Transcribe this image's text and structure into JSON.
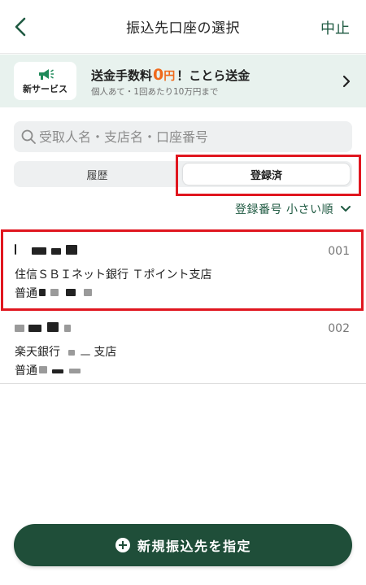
{
  "header": {
    "title": "振込先口座の選択",
    "cancel_label": "中止"
  },
  "banner": {
    "badge_label": "新サービス",
    "title_prefix": "送金手数料",
    "fee_amount": "0",
    "fee_unit": "円",
    "title_suffix": "！ことら送金",
    "subtitle": "個人あて・1回あたり10万円まで"
  },
  "search": {
    "placeholder": "受取人名・支店名・口座番号"
  },
  "tabs": [
    {
      "label": "履歴",
      "active": false
    },
    {
      "label": "登録済",
      "active": true
    }
  ],
  "sort": {
    "label": "登録番号 小さい順"
  },
  "accounts": [
    {
      "number": "001",
      "bank": "住信ＳＢＩネット銀行 Ｔポイント支店",
      "account_type": "普通"
    },
    {
      "number": "002",
      "bank": "楽天銀行",
      "branch_suffix": "支店",
      "account_type": "普通"
    }
  ],
  "cta": {
    "label": "新規振込先を指定"
  },
  "colors": {
    "brand_green": "#1f4e39",
    "accent_orange": "#ef6a1c",
    "highlight_red": "#e0161f",
    "banner_bg": "#e8f2ee"
  }
}
